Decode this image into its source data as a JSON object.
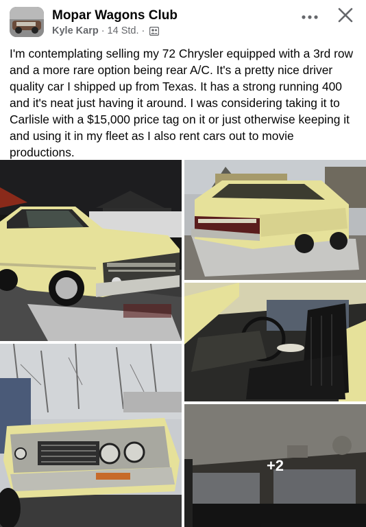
{
  "group": {
    "name": "Mopar Wagons Club"
  },
  "post": {
    "author": "Kyle Karp",
    "separator": "·",
    "time": "14 Std.",
    "separator2": "·",
    "audience_icon": "group-audience-icon",
    "text": "I'm contemplating selling my 72 Chrysler equipped with a 3rd row and a more rare option being rear A/C. It's a pretty nice driver quality car I shipped up from Texas. It has a strong running 400 and it's neat just having it around. I was considering taking it to Carlisle with a $15,000 price tag on it or just otherwise keeping it and using it in my fleet as I also rent cars out to movie productions."
  },
  "actions": {
    "more_icon": "more-options-icon",
    "close_icon": "close-icon"
  },
  "photos": {
    "more_count": "+2"
  },
  "colors": {
    "car_yellow": "#e6e19a",
    "meta_gray": "#65676b"
  }
}
